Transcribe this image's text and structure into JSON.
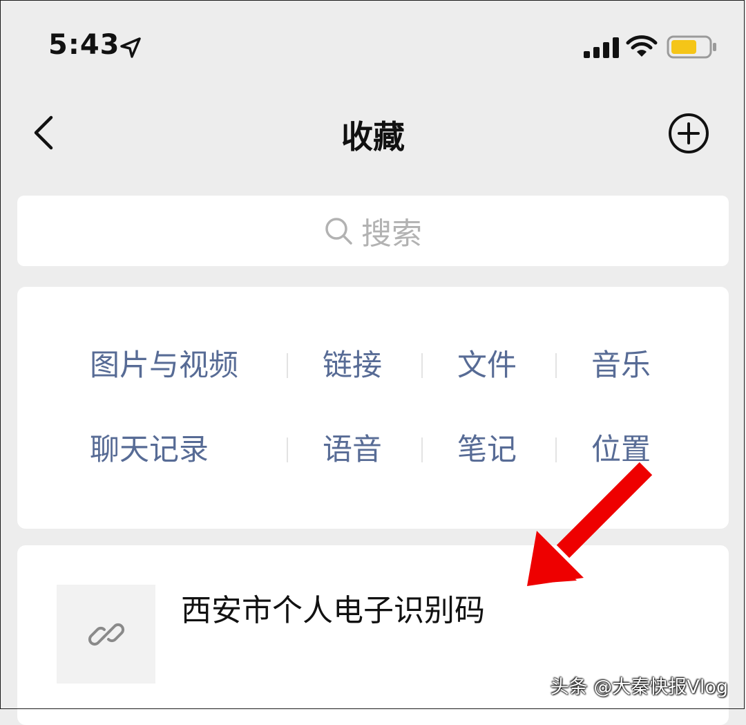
{
  "status_bar": {
    "time": "5:43"
  },
  "nav": {
    "title": "收藏"
  },
  "search": {
    "placeholder": "搜索"
  },
  "categories": [
    [
      "图片与视频",
      "链接",
      "文件",
      "音乐"
    ],
    [
      "聊天记录",
      "语音",
      "笔记",
      "位置"
    ]
  ],
  "favorite_item": {
    "title": "西安市个人电子识别码"
  },
  "watermark": "头条 @大秦快报Vlog",
  "colors": {
    "background": "#ededed",
    "category_text": "#576b95",
    "battery_fill": "#f5c518",
    "annotation_arrow": "#ee0000"
  },
  "icons": [
    "location-arrow-icon",
    "signal-icon",
    "wifi-icon",
    "battery-icon",
    "back-chevron-icon",
    "add-circle-icon",
    "search-icon",
    "link-icon",
    "annotation-arrow-icon"
  ]
}
